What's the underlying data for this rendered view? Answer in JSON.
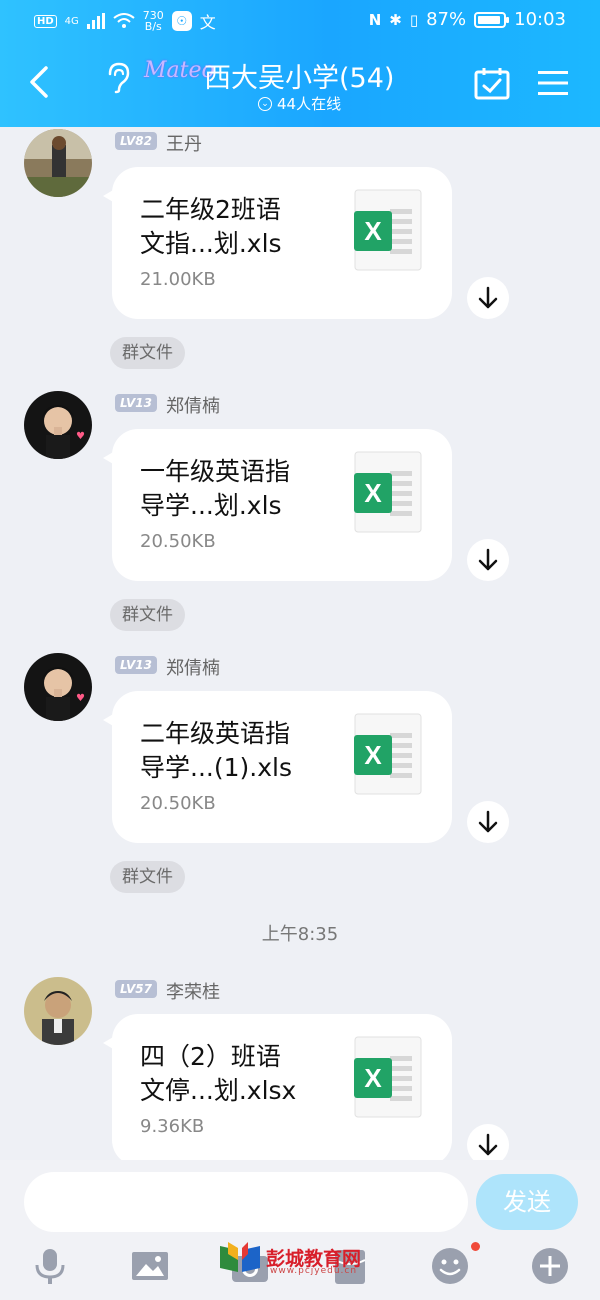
{
  "status_bar": {
    "hd": "HD",
    "network": "4G",
    "speed": "730\nB/s",
    "speed_line1": "730",
    "speed_line2": "B/s",
    "battery": "87%",
    "time": "10:03"
  },
  "header": {
    "logo_text": "Mateo",
    "title": "西大吴小学(54)",
    "online": "44人在线"
  },
  "messages": [
    {
      "level": "LV82",
      "user": "王丹",
      "file_name": "二年级2班语文指...划.xls",
      "file_line1": "二年级2班语",
      "file_line2": "文指...划.xls",
      "size": "21.00KB",
      "tag": "群文件"
    },
    {
      "level": "LV13",
      "user": "郑倩楠",
      "file_name": "一年级英语指导学...划.xls",
      "file_line1": "一年级英语指",
      "file_line2": "导学...划.xls",
      "size": "20.50KB",
      "tag": "群文件"
    },
    {
      "level": "LV13",
      "user": "郑倩楠",
      "file_name": "二年级英语指导学...(1).xls",
      "file_line1": "二年级英语指",
      "file_line2": "导学...(1).xls",
      "size": "20.50KB",
      "tag": "群文件"
    },
    {
      "level": "LV57",
      "user": "李荣桂",
      "file_name": "四（2）班语文停...划.xlsx",
      "file_line1": "四（2）班语",
      "file_line2": "文停...划.xlsx",
      "size": "9.36KB"
    }
  ],
  "timestamp": "上午8:35",
  "input": {
    "send_label": "发送"
  },
  "watermark": {
    "title": "彭城教育网",
    "sub": "www.pcjyedu.cn"
  },
  "colors": {
    "header": "#1aa6ff",
    "excel_green": "#21a366",
    "send_bg": "#aee4fb",
    "notify_dot": "#f04a3a"
  }
}
